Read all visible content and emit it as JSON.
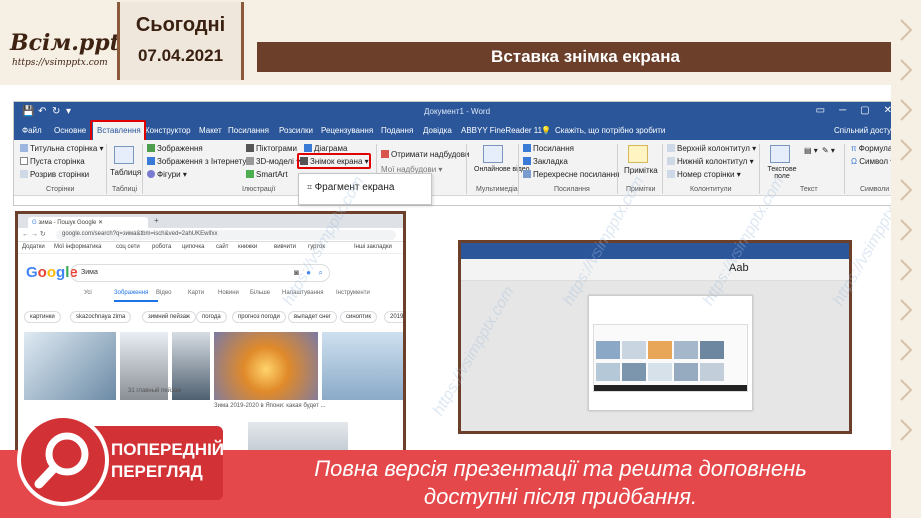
{
  "header": {
    "logo": "Всім.pptx",
    "logo_url": "https://vsimpptx.com",
    "day": "Сьогодні",
    "date": "07.04.2021",
    "slide_title": "Вставка знімка екрана"
  },
  "word": {
    "doc_title": "Документ1 - Word",
    "tabs": [
      "Файл",
      "Основне",
      "Вставлення",
      "Конструктор",
      "Макет",
      "Посилання",
      "Розсилки",
      "Рецензування",
      "Подання",
      "Довідка",
      "ABBYY FineReader 11",
      "Скажіть, що потрібно зробити",
      "Спільний доступ"
    ],
    "ribbon": {
      "pages": [
        "Титульна сторінка",
        "Пуста сторінка",
        "Розрив сторінки"
      ],
      "pages_group": "Сторінки",
      "table": "Таблиця",
      "tables_group": "Таблиці",
      "illus_col1": [
        "Зображення",
        "Зображення з Інтернету",
        "Фігури"
      ],
      "illus_col2": [
        "Піктограми",
        "3D-моделі",
        "SmartArt"
      ],
      "illus_col3": [
        "Діаграма",
        "Знімок екрана"
      ],
      "illus_group": "Ілюстрації",
      "addins": [
        "Отримати надбудови",
        "Мої надбудови"
      ],
      "online_video": "Онлайнове відео",
      "media_group": "Мультимедіа",
      "links": [
        "Посилання",
        "Закладка",
        "Перехресне посилання"
      ],
      "links_group": "Посилання",
      "comment": "Примітка",
      "comments_group": "Примітки",
      "hf": [
        "Верхній колонтитул",
        "Нижній колонтитул",
        "Номер сторінки"
      ],
      "hf_group": "Колонтитули",
      "textbox": "Текстове поле",
      "text_group": "Текст",
      "symbols": [
        "Формула",
        "Символ"
      ],
      "symbols_group": "Символи"
    },
    "dropdown_item": "Фрагмент екрана"
  },
  "browser": {
    "tab_title": "зима - Пошук Google",
    "address": "google.com/search?q=зима&tbm=isch&ved=2ahUKEwifxx",
    "bookmarks": [
      "Додатки",
      "Мої інформатика",
      "соц сети",
      "робота",
      "ципочка",
      "сайт",
      "книжки",
      "вивчити",
      "гурток",
      "Інші закладки"
    ],
    "query": "Зима",
    "nav": [
      "Усі",
      "Зображення",
      "Відео",
      "Карти",
      "Новини",
      "Більше",
      "Налаштування",
      "Інструменти"
    ],
    "chips": [
      "картинки",
      "skazochnaya zima",
      "зимний пейзаж",
      "погода",
      "прогноз погоди",
      "выпадет снег",
      "синоптик",
      "2019"
    ],
    "captions": [
      "Зима 2019-2020 в Япони: какая будет ...",
      "31 главный пейзаж"
    ]
  },
  "banner": {
    "badge_line1": "ПОПЕРЕДНІЙ",
    "badge_line2": "ПЕРЕГЛЯД",
    "line1": "Повна версія презентації та решта доповнень",
    "line2": "доступні після придбання."
  },
  "watermark": "https://vsimpptx.com",
  "colors": {
    "brown": "#6b3f2a",
    "word_blue": "#2b579a",
    "banner_red": "#e5484a",
    "highlight_red": "#e00000"
  }
}
